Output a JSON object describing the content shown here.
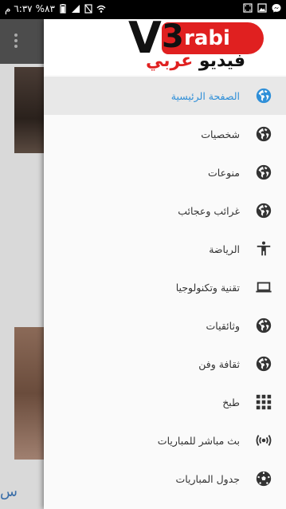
{
  "status_bar": {
    "time": "٦:٣٧ م",
    "battery": "%٨٣",
    "left_icons": [
      "messenger-icon",
      "gallery-icon",
      "screenshot-icon"
    ],
    "right_icons": [
      "wifi-icon",
      "no-sim-icon",
      "signal-icon",
      "battery-icon"
    ]
  },
  "drawer": {
    "logo": {
      "v": "V",
      "three": "3",
      "rabi": "rabi",
      "arabic_black": "فيديو",
      "arabic_red": "عربي"
    },
    "items": [
      {
        "label": "الصفحة الرئيسية",
        "icon": "globe-icon",
        "active": true
      },
      {
        "label": "شخصيات",
        "icon": "globe-icon"
      },
      {
        "label": "منوعات",
        "icon": "globe-icon"
      },
      {
        "label": "غرائب وعجائب",
        "icon": "globe-icon"
      },
      {
        "label": "الرياضة",
        "icon": "accessibility-icon"
      },
      {
        "label": "تقنية وتكنولوجيا",
        "icon": "laptop-icon"
      },
      {
        "label": "وثائقيات",
        "icon": "globe-icon"
      },
      {
        "label": "ثقافة وفن",
        "icon": "globe-icon"
      },
      {
        "label": "طبخ",
        "icon": "apps-grid-icon"
      },
      {
        "label": "بث مباشر للمباريات",
        "icon": "broadcast-icon"
      },
      {
        "label": "جدول المباريات",
        "icon": "soccer-ball-icon"
      }
    ]
  },
  "background": {
    "caption_fragment": "س"
  },
  "colors": {
    "accent": "#2f8fd8",
    "logo_red": "#e02020",
    "icon": "#333333"
  }
}
